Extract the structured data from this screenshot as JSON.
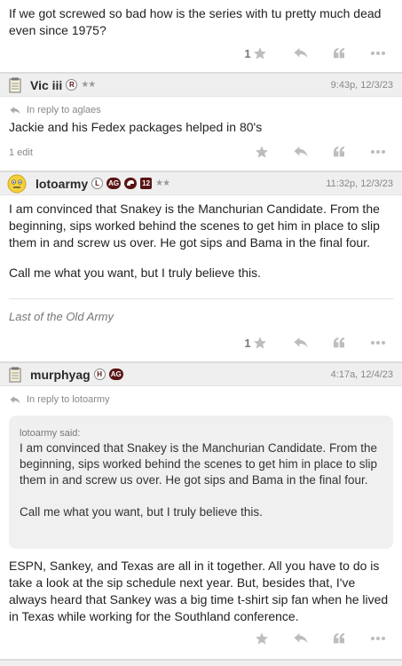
{
  "posts": [
    {
      "body": "If we got screwed so bad how is the series with tu pretty much dead even since 1975?",
      "star_count": "1"
    },
    {
      "username": "Vic iii",
      "badges": [
        "R"
      ],
      "stars": "★★",
      "timestamp": "9:43p, 12/3/23",
      "reply_to": "In reply to aglaes",
      "body": "Jackie and his Fedex packages helped in 80's",
      "edit_note": "1 edit"
    },
    {
      "username": "lotoarmy",
      "badges": [
        "L",
        "AG",
        "",
        "12"
      ],
      "stars": "★★",
      "timestamp": "11:32p, 12/3/23",
      "body_p1": "I am convinced that Snakey is the Manchurian Candidate. From the beginning, sips worked behind the scenes to get him in place to slip them in and screw us over. He got sips and Bama in the final four.",
      "body_p2": "Call me what you want, but I truly believe this.",
      "signature": "Last of the Old Army",
      "star_count": "1"
    },
    {
      "username": "murphyag",
      "badges": [
        "H",
        "AG"
      ],
      "timestamp": "4:17a, 12/4/23",
      "reply_to": "In reply to lotoarmy",
      "quote_author": "lotoarmy said:",
      "quote_p1": "I am convinced that Snakey is the Manchurian Candidate. From the beginning, sips worked behind the scenes to get him in place to slip them in and screw us over. He got sips and Bama in the final four.",
      "quote_p2": "Call me what you want, but I truly believe this.",
      "body": "ESPN, Sankey, and Texas are all in it together. All you have to do is take a look at the sip schedule next year. But, besides that, I've always heard that Sankey was a big time t-shirt sip fan when he lived in Texas while working for the Southland conference."
    }
  ],
  "icons": {
    "star": "star-icon",
    "reply": "reply-icon",
    "quote": "quote-icon",
    "more": "more-icon",
    "notepad": "notepad-icon",
    "avatar": "face-avatar-icon"
  },
  "colors": {
    "header_bg": "#efefef",
    "maroon": "#5a1414",
    "icon_gray": "#b5b5b5",
    "quote_bg": "#f0f0f0"
  }
}
